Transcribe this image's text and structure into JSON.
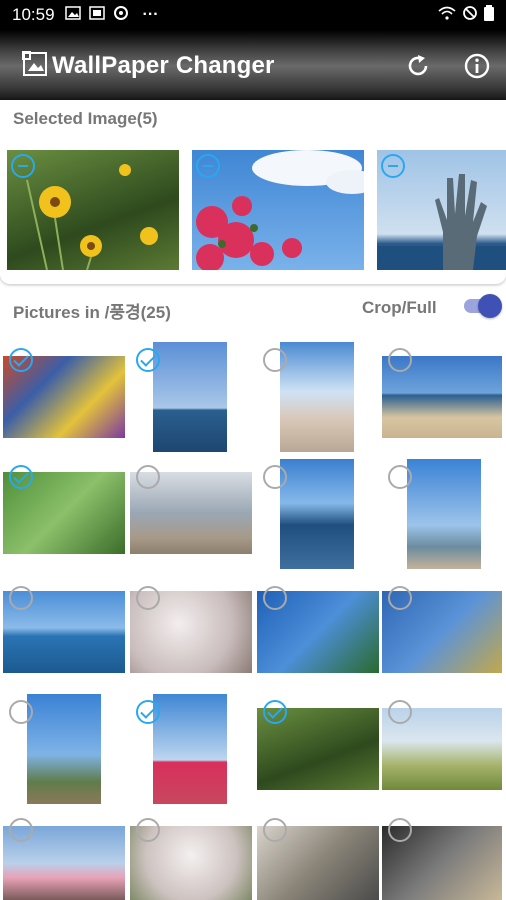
{
  "status_bar": {
    "time": "10:59",
    "dots": "···"
  },
  "app_bar": {
    "title": "WallPaper Changer"
  },
  "selected": {
    "title": "Selected Image(5)"
  },
  "pictures": {
    "title": "Pictures in /풍경(25)",
    "mode_label": "Crop/Full",
    "mode_full": true
  },
  "grid_selected": [
    true,
    true,
    false,
    false,
    true,
    false,
    false,
    false,
    false,
    false,
    false,
    false,
    false,
    true,
    true,
    false,
    false,
    false,
    false,
    false
  ],
  "colors": {
    "accent": "#29a8f0",
    "toggle": "#3f51b5",
    "section_text": "#777777"
  }
}
